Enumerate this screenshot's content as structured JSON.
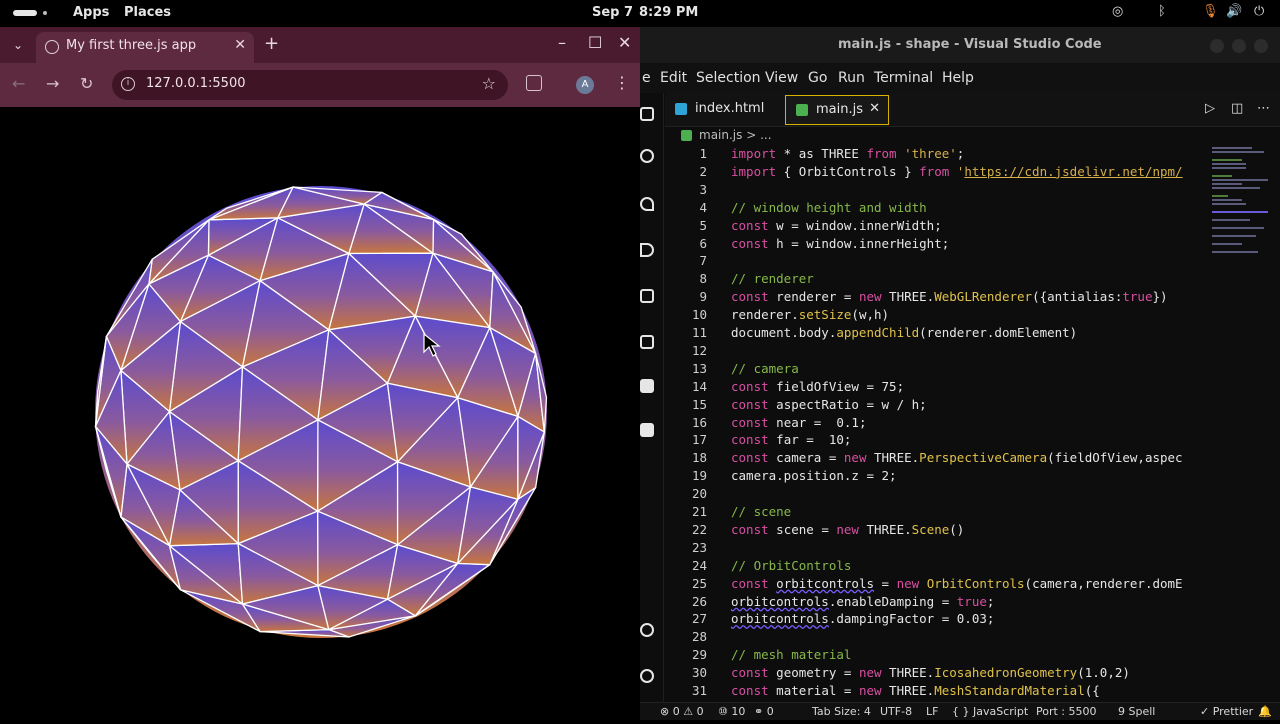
{
  "system_bar": {
    "apps": "Apps",
    "places": "Places",
    "date": "Sep 7",
    "time": "8:29 PM"
  },
  "browser": {
    "tab_title": "My first three.js app",
    "url": "127.0.0.1:5500",
    "avatar_letter": "A",
    "sphere_colors": {
      "top": "#5b4bcf",
      "bottom": "#c8763c",
      "wire": "#ffffff"
    }
  },
  "vscode": {
    "window_title": "main.js - shape - Visual Studio Code",
    "menu": [
      "e",
      "Edit",
      "Selection",
      "View",
      "Go",
      "Run",
      "Terminal",
      "Help"
    ],
    "tabs": [
      {
        "label": "index.html",
        "color": "#2ea3d6"
      },
      {
        "label": "main.js",
        "color": "#4caf50"
      }
    ],
    "breadcrumb": "main.js > ...",
    "code": [
      {
        "n": "1",
        "t": [
          [
            "import",
            "kw"
          ],
          [
            " * as THREE ",
            ""
          ],
          [
            "from",
            "kw"
          ],
          [
            " ",
            ""
          ],
          [
            "'three'",
            "str"
          ],
          [
            ";",
            ""
          ]
        ]
      },
      {
        "n": "2",
        "t": [
          [
            "import",
            "kw"
          ],
          [
            " { OrbitControls } ",
            ""
          ],
          [
            "from",
            "kw"
          ],
          [
            " '",
            "str"
          ],
          [
            "https://cdn.jsdelivr.net/npm/",
            "url"
          ]
        ]
      },
      {
        "n": "3",
        "t": []
      },
      {
        "n": "4",
        "t": [
          [
            "// window height and width",
            "cm"
          ]
        ]
      },
      {
        "n": "5",
        "t": [
          [
            "const",
            "kw"
          ],
          [
            " w = window.innerWidth;",
            ""
          ]
        ]
      },
      {
        "n": "6",
        "t": [
          [
            "const",
            "kw"
          ],
          [
            " h = window.innerHeight;",
            ""
          ]
        ]
      },
      {
        "n": "7",
        "t": []
      },
      {
        "n": "8",
        "t": [
          [
            "// renderer",
            "cm"
          ]
        ]
      },
      {
        "n": "9",
        "t": [
          [
            "const",
            "kw"
          ],
          [
            " renderer = ",
            ""
          ],
          [
            "new",
            "kw"
          ],
          [
            " THREE.",
            ""
          ],
          [
            "WebGLRenderer",
            "cls"
          ],
          [
            "({antialias:",
            ""
          ],
          [
            "true",
            "kw"
          ],
          [
            "})",
            ""
          ]
        ]
      },
      {
        "n": "10",
        "t": [
          [
            "renderer.",
            ""
          ],
          [
            "setSize",
            "fn"
          ],
          [
            "(w,h)",
            ""
          ]
        ]
      },
      {
        "n": "11",
        "t": [
          [
            "document.body.",
            ""
          ],
          [
            "appendChild",
            "fn"
          ],
          [
            "(renderer.domElement)",
            ""
          ]
        ]
      },
      {
        "n": "12",
        "t": []
      },
      {
        "n": "13",
        "t": [
          [
            "// camera",
            "cm"
          ]
        ]
      },
      {
        "n": "14",
        "t": [
          [
            "const",
            "kw"
          ],
          [
            " fieldOfView = 75;",
            ""
          ]
        ]
      },
      {
        "n": "15",
        "t": [
          [
            "const",
            "kw"
          ],
          [
            " aspectRatio = w / h;",
            ""
          ]
        ]
      },
      {
        "n": "16",
        "t": [
          [
            "const",
            "kw"
          ],
          [
            " near =  0.1;",
            ""
          ]
        ]
      },
      {
        "n": "17",
        "t": [
          [
            "const",
            "kw"
          ],
          [
            " far =  10;",
            ""
          ]
        ]
      },
      {
        "n": "18",
        "t": [
          [
            "const",
            "kw"
          ],
          [
            " camera = ",
            ""
          ],
          [
            "new",
            "kw"
          ],
          [
            " THREE.",
            ""
          ],
          [
            "PerspectiveCamera",
            "cls"
          ],
          [
            "(fieldOfView,aspec",
            ""
          ]
        ]
      },
      {
        "n": "19",
        "t": [
          [
            "camera.position.z = 2;",
            ""
          ]
        ]
      },
      {
        "n": "20",
        "t": []
      },
      {
        "n": "21",
        "t": [
          [
            "// scene",
            "cm"
          ]
        ]
      },
      {
        "n": "22",
        "t": [
          [
            "const",
            "kw"
          ],
          [
            " scene = ",
            ""
          ],
          [
            "new",
            "kw"
          ],
          [
            " THREE.",
            ""
          ],
          [
            "Scene",
            "cls"
          ],
          [
            "()",
            ""
          ]
        ]
      },
      {
        "n": "23",
        "t": []
      },
      {
        "n": "24",
        "t": [
          [
            "// OrbitControls",
            "cm"
          ]
        ]
      },
      {
        "n": "25",
        "t": [
          [
            "const",
            "kw"
          ],
          [
            " ",
            ""
          ],
          [
            "orbitcontrols",
            "ul"
          ],
          [
            " = ",
            ""
          ],
          [
            "new",
            "kw"
          ],
          [
            " ",
            ""
          ],
          [
            "OrbitControls",
            "cls"
          ],
          [
            "(camera,renderer.domE",
            ""
          ]
        ]
      },
      {
        "n": "26",
        "t": [
          [
            "orbitcontrols",
            "ul"
          ],
          [
            ".enableDamping = ",
            ""
          ],
          [
            "true",
            "kw"
          ],
          [
            ";",
            ""
          ]
        ]
      },
      {
        "n": "27",
        "t": [
          [
            "orbitcontrols",
            "ul"
          ],
          [
            ".dampingFactor = 0.03;",
            ""
          ]
        ]
      },
      {
        "n": "28",
        "t": []
      },
      {
        "n": "29",
        "t": [
          [
            "// mesh material",
            "cm"
          ]
        ]
      },
      {
        "n": "30",
        "t": [
          [
            "const",
            "kw"
          ],
          [
            " geometry = ",
            ""
          ],
          [
            "new",
            "kw"
          ],
          [
            " THREE.",
            ""
          ],
          [
            "IcosahedronGeometry",
            "cls"
          ],
          [
            "(1.0,2)",
            ""
          ]
        ]
      },
      {
        "n": "31",
        "t": [
          [
            "const",
            "kw"
          ],
          [
            " material = ",
            ""
          ],
          [
            "new",
            "kw"
          ],
          [
            " THREE.",
            ""
          ],
          [
            "MeshStandardMaterial",
            "cls"
          ],
          [
            "({",
            ""
          ]
        ]
      }
    ],
    "status": {
      "problems": "⊗ 0 ⚠ 0",
      "ports": "⑩ 10",
      "radio": "⚭ 0",
      "tab_size": "Tab Size: 4",
      "encoding": "UTF-8",
      "eol": "LF",
      "language": "{ } JavaScript",
      "port": "Port : 5500",
      "spell": "9 Spell",
      "prettier": "✓ Prettier"
    }
  }
}
